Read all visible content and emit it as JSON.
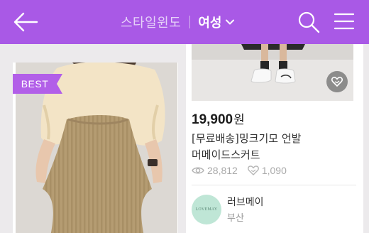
{
  "header": {
    "title": "스타일윈도",
    "gender_filter": "여성",
    "icons": [
      "arrow-left-icon",
      "chevron-down-icon",
      "search-icon",
      "menu-icon"
    ],
    "bg_color": "#a959e6"
  },
  "products": [
    {
      "badge": "BEST",
      "badge_color": "#b25fe8",
      "image": "knit-skirt-photo"
    },
    {
      "image": "white-sneakers-photo",
      "price": "19,900",
      "currency": "원",
      "name_line1": "[무료배송]밍크기모 언발",
      "name_line2": "머메이드스커트",
      "views": "28,812",
      "likes": "1,090",
      "seller": {
        "name": "러브메이",
        "location": "부산",
        "avatar_text": "LOVEMAY"
      }
    }
  ]
}
